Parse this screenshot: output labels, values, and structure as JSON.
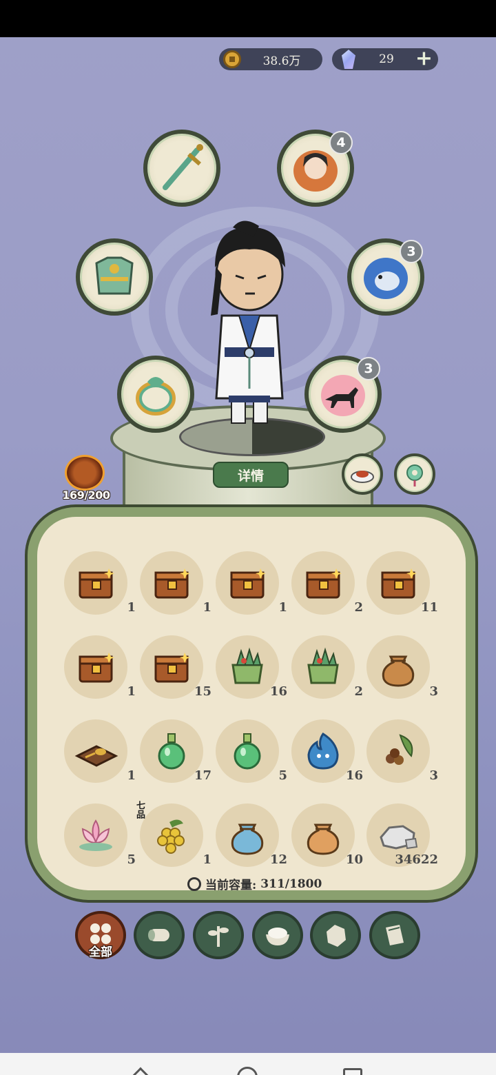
{
  "currency": {
    "coins": "38.6万",
    "gems": "29",
    "add_symbol": "+"
  },
  "equipment_slots": [
    {
      "name": "weapon",
      "icon": "sword-icon"
    },
    {
      "name": "companion",
      "icon": "companion-portrait-icon",
      "badge": "4"
    },
    {
      "name": "armor",
      "icon": "armor-icon"
    },
    {
      "name": "spirit-beast",
      "icon": "spirit-beast-icon",
      "badge": "3"
    },
    {
      "name": "ring",
      "icon": "ring-icon"
    },
    {
      "name": "mount",
      "icon": "wolf-icon",
      "badge": "3"
    }
  ],
  "details_button": "详情",
  "energy": "169/200",
  "inventory": [
    {
      "icon": "chest-icon",
      "count": "1"
    },
    {
      "icon": "chest-icon",
      "count": "1"
    },
    {
      "icon": "chest-icon",
      "count": "1"
    },
    {
      "icon": "chest-icon",
      "count": "2"
    },
    {
      "icon": "chest-icon",
      "count": "11"
    },
    {
      "icon": "chest-icon",
      "count": "1"
    },
    {
      "icon": "chest-icon",
      "count": "15"
    },
    {
      "icon": "herb-basket-icon",
      "count": "16"
    },
    {
      "icon": "herb-basket-icon",
      "count": "2"
    },
    {
      "icon": "pouch-icon",
      "count": "3"
    },
    {
      "icon": "spoon-board-icon",
      "count": "1"
    },
    {
      "icon": "potion-icon",
      "count": "17"
    },
    {
      "icon": "potion-icon",
      "count": "5"
    },
    {
      "icon": "spirit-flame-icon",
      "count": "16"
    },
    {
      "icon": "seeds-icon",
      "count": "3"
    },
    {
      "icon": "lotus-icon",
      "count": "5"
    },
    {
      "icon": "fruit-icon",
      "count": "1",
      "tag": "七品"
    },
    {
      "icon": "pouch-icon",
      "count": "12"
    },
    {
      "icon": "pouch-icon",
      "count": "10"
    },
    {
      "icon": "ore-icon",
      "count": "34622"
    }
  ],
  "capacity": {
    "label": "当前容量:",
    "value": "311/1800"
  },
  "tabs": [
    {
      "label": "全部",
      "icon": "grid-icon",
      "active": true
    },
    {
      "icon": "wood-log-icon"
    },
    {
      "icon": "herb-icon"
    },
    {
      "icon": "rice-bowl-icon"
    },
    {
      "icon": "ore-chunk-icon"
    },
    {
      "icon": "scroll-icon"
    }
  ],
  "colors": {
    "panel_border": "#8aa06f",
    "active_tab": "#9a4a2c",
    "tab": "#3f5e4a",
    "badge": "#7d8286"
  }
}
